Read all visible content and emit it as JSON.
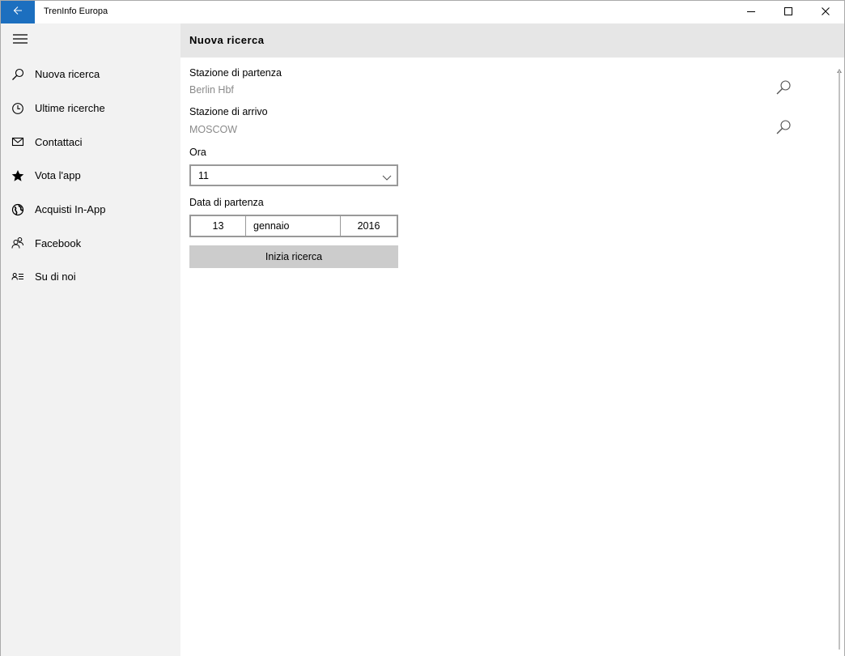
{
  "titlebar": {
    "app_title": "TrenInfo Europa",
    "back_icon": "arrow-left-icon",
    "accent": "#1c6fbf"
  },
  "sidebar": {
    "menu_icon": "hamburger-icon",
    "items": [
      {
        "label": "Nuova ricerca",
        "icon": "search-icon"
      },
      {
        "label": "Ultime ricerche",
        "icon": "clock-icon"
      },
      {
        "label": "Contattaci",
        "icon": "mail-icon"
      },
      {
        "label": "Vota l'app",
        "icon": "star-icon"
      },
      {
        "label": "Acquisti In-App",
        "icon": "globe-icon"
      },
      {
        "label": "Facebook",
        "icon": "people-icon"
      },
      {
        "label": "Su di noi",
        "icon": "contact-card-icon"
      }
    ]
  },
  "header": {
    "title": "Nuova ricerca"
  },
  "form": {
    "departure_label": "Stazione di partenza",
    "departure_value": "Berlin Hbf",
    "arrival_label": "Stazione di arrivo",
    "arrival_value": "MOSCOW",
    "time_label": "Ora",
    "time_value": "11",
    "date_label": "Data di partenza",
    "date_day": "13",
    "date_month": "gennaio",
    "date_year": "2016",
    "submit_label": "Inizia ricerca"
  }
}
